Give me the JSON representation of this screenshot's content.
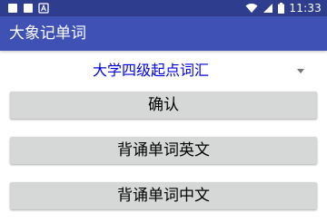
{
  "status_bar": {
    "time": "11:33",
    "left_icons": [
      "square-notification-icon",
      "square-notification-icon",
      "a-notification-icon"
    ],
    "right_icons": [
      "wifi-icon",
      "cellular-signal-icon",
      "battery-icon"
    ],
    "left_icon_letter": "A"
  },
  "app_bar": {
    "title": "大象记单词"
  },
  "spinner": {
    "selected_value": "大学四级起点词汇",
    "arrow_icon": "dropdown-arrow-icon"
  },
  "buttons": {
    "confirm": "确认",
    "recite_english": "背诵单词英文",
    "recite_chinese": "背诵单词中文"
  },
  "colors": {
    "status_bar": "#2f3d8f",
    "app_bar": "#3f51b5",
    "spinner_text": "#0000e6",
    "button_bg": "#d6d7d7"
  }
}
